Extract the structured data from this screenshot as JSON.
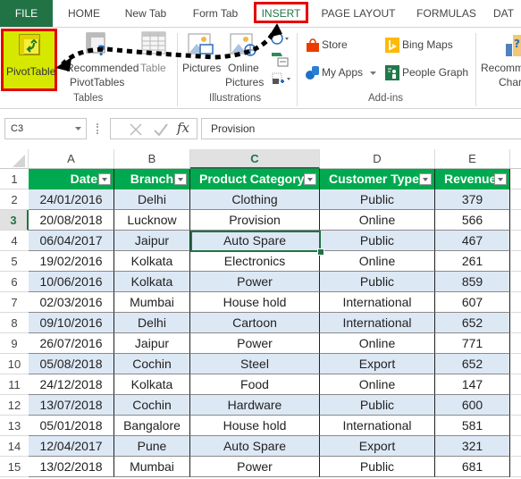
{
  "ribbon_tabs": [
    {
      "label": "FILE",
      "active": false
    },
    {
      "label": "HOME",
      "active": false
    },
    {
      "label": "New Tab",
      "active": false
    },
    {
      "label": "Form Tab",
      "active": false
    },
    {
      "label": "INSERT",
      "active": true
    },
    {
      "label": "PAGE LAYOUT",
      "active": false
    },
    {
      "label": "FORMULAS",
      "active": false
    },
    {
      "label": "DAT",
      "active": false
    }
  ],
  "ribbon": {
    "tables": {
      "group_label": "Tables",
      "pivottable": "PivotTable",
      "recommended_line1": "Recommended",
      "recommended_line2": "PivotTables",
      "table": "Table"
    },
    "illustrations": {
      "group_label": "Illustrations",
      "pictures": "Pictures",
      "online_line1": "Online",
      "online_line2": "Pictures"
    },
    "addins": {
      "group_label": "Add-ins",
      "store": "Store",
      "my_apps": "My Apps",
      "bing_maps": "Bing Maps",
      "people_graph": "People Graph"
    },
    "charts": {
      "recommended_line1": "Recommended",
      "recommended_line2": "Charts"
    }
  },
  "formula_bar": {
    "name_box": "C3",
    "formula": "Provision",
    "fx": "fx"
  },
  "sheet": {
    "columns": [
      "A",
      "B",
      "C",
      "D",
      "E"
    ],
    "selected_column": "C",
    "selected_row": "3",
    "headers": [
      "Date",
      "Branch",
      "Product Category",
      "Customer Type",
      "Revenue"
    ],
    "rows": [
      {
        "num": "2",
        "cells": [
          "24/01/2016",
          "Delhi",
          "Clothing",
          "Public",
          "379"
        ]
      },
      {
        "num": "3",
        "cells": [
          "20/08/2018",
          "Lucknow",
          "Provision",
          "Online",
          "566"
        ]
      },
      {
        "num": "4",
        "cells": [
          "06/04/2017",
          "Jaipur",
          "Auto Spare",
          "Public",
          "467"
        ]
      },
      {
        "num": "5",
        "cells": [
          "19/02/2016",
          "Kolkata",
          "Electronics",
          "Online",
          "261"
        ]
      },
      {
        "num": "6",
        "cells": [
          "10/06/2016",
          "Kolkata",
          "Power",
          "Public",
          "859"
        ]
      },
      {
        "num": "7",
        "cells": [
          "02/03/2016",
          "Mumbai",
          "House hold",
          "International",
          "607"
        ]
      },
      {
        "num": "8",
        "cells": [
          "09/10/2016",
          "Delhi",
          "Cartoon",
          "International",
          "652"
        ]
      },
      {
        "num": "9",
        "cells": [
          "26/07/2016",
          "Jaipur",
          "Power",
          "Online",
          "771"
        ]
      },
      {
        "num": "10",
        "cells": [
          "05/08/2018",
          "Cochin",
          "Steel",
          "Export",
          "652"
        ]
      },
      {
        "num": "11",
        "cells": [
          "24/12/2018",
          "Kolkata",
          "Food",
          "Online",
          "147"
        ]
      },
      {
        "num": "12",
        "cells": [
          "13/07/2018",
          "Cochin",
          "Hardware",
          "Public",
          "600"
        ]
      },
      {
        "num": "13",
        "cells": [
          "05/01/2018",
          "Bangalore",
          "House hold",
          "International",
          "581"
        ]
      },
      {
        "num": "14",
        "cells": [
          "12/04/2017",
          "Pune",
          "Auto Spare",
          "Export",
          "321"
        ]
      },
      {
        "num": "15",
        "cells": [
          "13/02/2018",
          "Mumbai",
          "Power",
          "Public",
          "681"
        ]
      }
    ]
  },
  "colors": {
    "accent_green": "#217346",
    "header_green": "#00a94f",
    "band_blue": "#dde8f5",
    "highlight_red": "#e60000",
    "highlight_yellow": "#d6e800"
  }
}
